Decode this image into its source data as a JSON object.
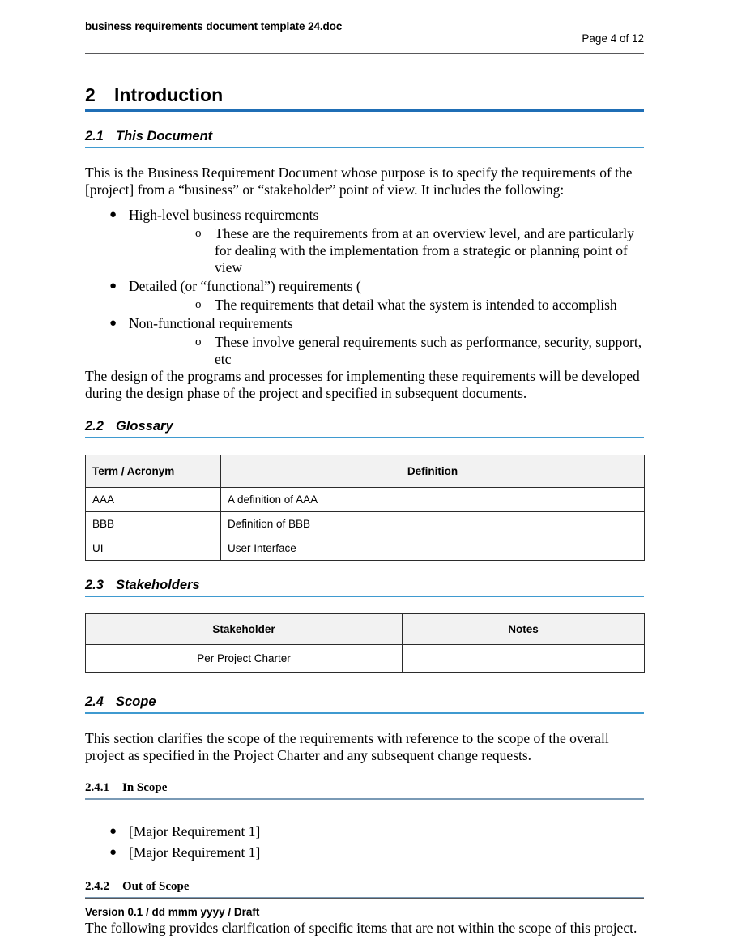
{
  "header": {
    "document_title": "business requirements document template 24.doc",
    "page_label": "Page 4 of 12"
  },
  "footer": {
    "version_line": "Version 0.1 / dd mmm yyyy / Draft"
  },
  "colors": {
    "h1_rule": "#1f6eb5",
    "h2_rule": "#3f9ad0",
    "h3_rule": "#7a9ab5",
    "header_rule": "#58585a",
    "table_header_fill": "#f2f2f2",
    "table_border": "#2b2b2b"
  },
  "sections": {
    "introduction": {
      "number": "2",
      "title": "Introduction"
    },
    "this_document": {
      "number": "2.1",
      "title": "This Document",
      "intro_paragraph": "This is the Business Requirement Document whose purpose is to specify the requirements of the [project] from a “business” or “stakeholder” point of view. It includes the following:",
      "bullets": [
        {
          "text": "High-level business requirements",
          "sub": [
            "These are the requirements from at an overview level, and are particularly for dealing with the implementation from a strategic or planning point of view"
          ]
        },
        {
          "text": "Detailed (or “functional”) requirements (",
          "sub": [
            "The requirements that detail what the system is intended to accomplish"
          ]
        },
        {
          "text": "Non-functional requirements",
          "sub": [
            "These involve general requirements such as performance, security, support, etc"
          ]
        }
      ],
      "closing_paragraph": "The design of the programs and processes for implementing these requirements will be developed during the design phase of the project and specified in subsequent documents."
    },
    "glossary": {
      "number": "2.2",
      "title": "Glossary",
      "table": {
        "columns": [
          "Term / Acronym",
          "Definition"
        ],
        "rows": [
          [
            "AAA",
            "A definition of AAA"
          ],
          [
            "BBB",
            "Definition of BBB"
          ],
          [
            "UI",
            "User Interface"
          ]
        ]
      }
    },
    "stakeholders": {
      "number": "2.3",
      "title": "Stakeholders",
      "table": {
        "columns": [
          "Stakeholder",
          "Notes"
        ],
        "rows": [
          [
            "Per Project Charter",
            ""
          ]
        ]
      }
    },
    "scope": {
      "number": "2.4",
      "title": "Scope",
      "paragraph": "This section clarifies the scope of the requirements with reference to the scope of the overall project as specified in the Project Charter and any subsequent change requests.",
      "in_scope": {
        "number": "2.4.1",
        "title": "In Scope",
        "bullets": [
          "[Major Requirement 1]",
          "[Major Requirement 1]"
        ]
      },
      "out_of_scope": {
        "number": "2.4.2",
        "title": "Out of Scope",
        "paragraph": "The following provides clarification of specific items that are not within the scope of this project."
      }
    }
  }
}
